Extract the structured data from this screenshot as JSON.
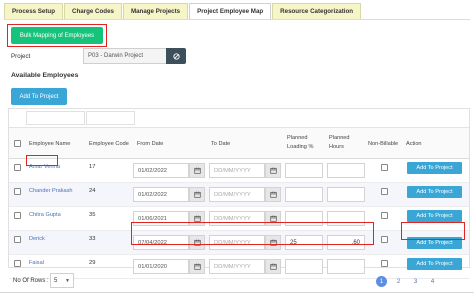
{
  "tabs": [
    "Process Setup",
    "Charge Codes",
    "Manage Projects",
    "Project Employee Map",
    "Resource Categorization"
  ],
  "bulk_button": "Bulk Mapping of Employees",
  "project": {
    "label": "Project",
    "value": "P03 - Darwin Project"
  },
  "section_title": "Available Employees",
  "add_to_project_top": "Add To Project",
  "columns": {
    "employee_name": "Employee Name",
    "employee_code": "Employee Code",
    "from_date": "From Date",
    "to_date": "To Date",
    "planned_loading_1": "Planned",
    "planned_loading_2": "Loading %",
    "planned_hours_1": "Planned",
    "planned_hours_2": "Hours",
    "non_billable": "Non-Billable",
    "action": "Action"
  },
  "date_placeholder": "DD/MM/YYYY",
  "rows": [
    {
      "name": "Amar Verma",
      "code": "17",
      "from": "01/02/2022",
      "to": "DD/MM/YYYY",
      "loading": "",
      "hours": "",
      "action": "Add To Project"
    },
    {
      "name": "Chander Prakash",
      "code": "24",
      "from": "01/02/2022",
      "to": "DD/MM/YYYY",
      "loading": "",
      "hours": "",
      "action": "Add To Project"
    },
    {
      "name": "Chitra Gupta",
      "code": "35",
      "from": "01/06/2021",
      "to": "DD/MM/YYYY",
      "loading": "",
      "hours": "",
      "action": "Add To Project"
    },
    {
      "name": "Derick",
      "code": "33",
      "from": "07/04/2022",
      "to": "DD/MM/YYYY",
      "loading": "25",
      "hours": ".60",
      "action": "Add To Project"
    },
    {
      "name": "Faisal",
      "code": "29",
      "from": "01/01/2020",
      "to": "DD/MM/YYYY",
      "loading": "",
      "hours": "",
      "action": "Add To Project"
    }
  ],
  "footer": {
    "rows_label": "No Of Rows :",
    "rows_value": "5"
  },
  "pagination": [
    "1",
    "2",
    "3",
    "4"
  ],
  "pagination_active": "1",
  "colors": {
    "green": "#17c37b",
    "blue": "#3aa6d6",
    "highlight": "#e52222",
    "tab_bg": "#f5f5c8"
  },
  "icons": [
    "calendar-icon",
    "clear-icon",
    "chevron-down-icon"
  ]
}
